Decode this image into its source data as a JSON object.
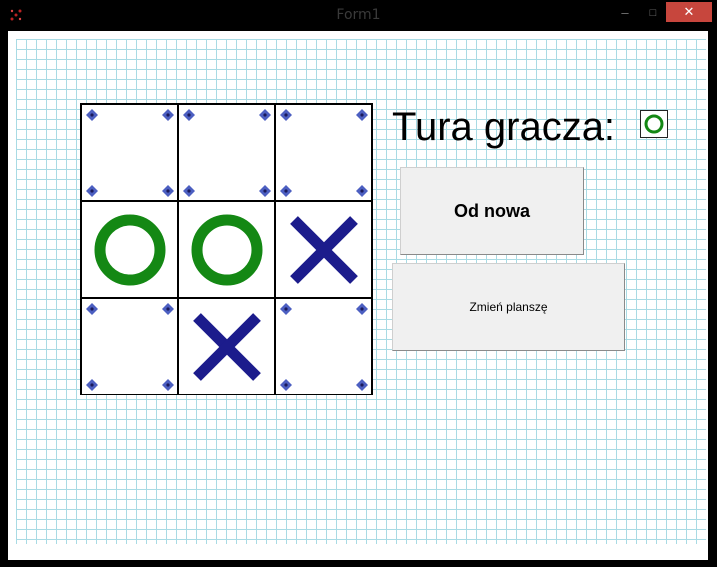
{
  "window": {
    "title": "Form1",
    "controls": {
      "minimize": "–",
      "maximize": "□",
      "close": "✕"
    }
  },
  "board": {
    "cells": [
      [
        "",
        "",
        ""
      ],
      [
        "O",
        "O",
        "X"
      ],
      [
        "",
        "X",
        ""
      ]
    ],
    "empty_cell_marker": "blue-diamond-corner-icons"
  },
  "turn": {
    "label": "Tura gracza:",
    "current_player": "O"
  },
  "buttons": {
    "reset_label": "Od nowa",
    "change_board_label": "Zmień planszę"
  },
  "colors": {
    "o_mark": "#148814",
    "x_mark": "#1c1c8c",
    "grid_lines": "#a9dbe4",
    "corner_diamond": "#4c5fc1",
    "close_button": "#c7463d"
  }
}
